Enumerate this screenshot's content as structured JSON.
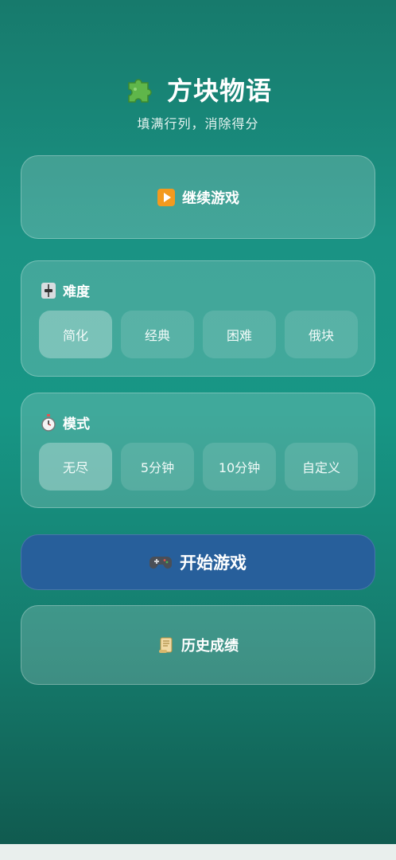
{
  "header": {
    "title": "方块物语",
    "subtitle": "填满行列，消除得分",
    "icon": "puzzle-piece-icon"
  },
  "continue_button": {
    "label": "继续游戏",
    "icon": "play-icon"
  },
  "difficulty": {
    "label": "难度",
    "icon": "slider-icon",
    "options": [
      "简化",
      "经典",
      "困难",
      "俄块"
    ],
    "selected": "简化"
  },
  "mode": {
    "label": "模式",
    "icon": "stopwatch-icon",
    "options": [
      "无尽",
      "5分钟",
      "10分钟",
      "自定义"
    ],
    "selected": "无尽"
  },
  "start_button": {
    "label": "开始游戏",
    "icon": "gamepad-icon",
    "color": "#275f9b"
  },
  "history_button": {
    "label": "历史成绩",
    "icon": "scroll-icon"
  }
}
